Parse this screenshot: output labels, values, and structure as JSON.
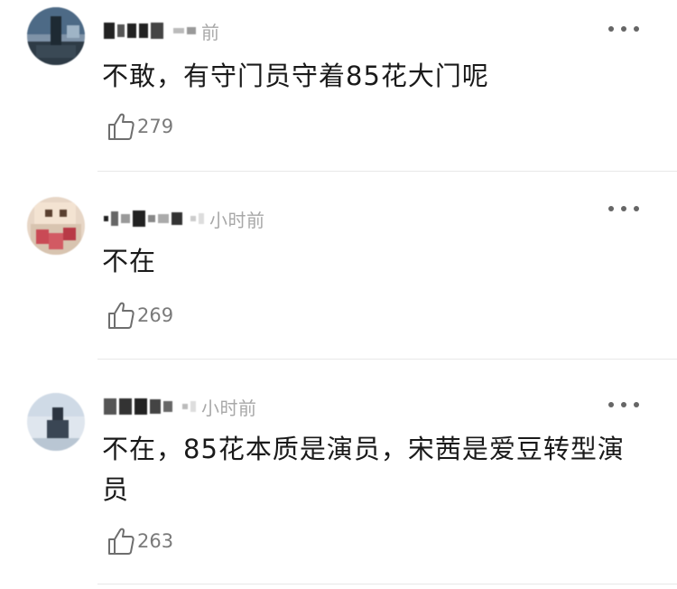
{
  "comments": [
    {
      "time": "前",
      "text": "不敢，有守门员守着85花大门呢",
      "likes": "279"
    },
    {
      "time": "小时前",
      "text": "不在",
      "likes": "269"
    },
    {
      "time": "小时前",
      "text": "不在，85花本质是演员，宋茜是爱豆转型演员",
      "likes": "263"
    }
  ],
  "icons": {
    "like": "thumbs-up-icon",
    "more": "more-dots-icon"
  },
  "colors": {
    "text": "#1a1a1a",
    "muted": "#a8a8a8",
    "like_count": "#7a7a7a",
    "divider": "#e8e8e8"
  }
}
